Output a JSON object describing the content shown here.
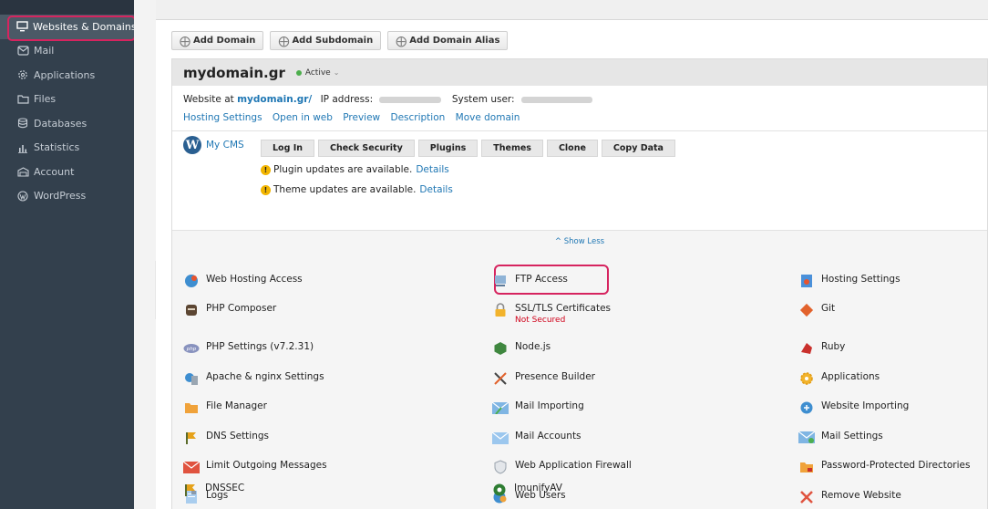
{
  "sidebar": {
    "items": [
      {
        "label": "Websites & Domains",
        "icon": "monitor-icon",
        "active": true
      },
      {
        "label": "Mail",
        "icon": "envelope-icon"
      },
      {
        "label": "Applications",
        "icon": "gear-icon"
      },
      {
        "label": "Files",
        "icon": "folder-icon"
      },
      {
        "label": "Databases",
        "icon": "database-icon"
      },
      {
        "label": "Statistics",
        "icon": "bar-chart-icon"
      },
      {
        "label": "Account",
        "icon": "account-icon"
      },
      {
        "label": "WordPress",
        "icon": "wordpress-icon"
      }
    ]
  },
  "toolbar": {
    "add_domain": "Add Domain",
    "add_subdomain": "Add Subdomain",
    "add_domain_alias": "Add Domain Alias"
  },
  "domain": {
    "name": "mydomain.gr",
    "status": "Active",
    "website_at_label": "Website at",
    "website_link": "mydomain.gr/",
    "ip_label": "IP address:",
    "system_user_label": "System user:",
    "links": [
      "Hosting Settings",
      "Open in web",
      "Preview",
      "Description",
      "Move domain"
    ]
  },
  "cms": {
    "name": "My CMS",
    "buttons": [
      "Log In",
      "Check Security",
      "Plugins",
      "Themes",
      "Clone",
      "Copy Data"
    ],
    "plugin_notice": "Plugin updates are available.",
    "theme_notice": "Theme updates are available.",
    "details": "Details"
  },
  "show_less": "^ Show Less",
  "tools": {
    "col1": [
      "Web Hosting Access",
      "PHP Composer",
      "PHP Settings (v7.2.31)",
      "Apache & nginx Settings",
      "File Manager",
      "DNS Settings",
      "Limit Outgoing Messages",
      "Logs",
      "DNSSEC"
    ],
    "col2": [
      "FTP Access",
      "SSL/TLS Certificates",
      "Node.js",
      "Presence Builder",
      "Mail Importing",
      "Mail Accounts",
      "Web Application Firewall",
      "Web Users",
      "ImunifyAV"
    ],
    "col3": [
      "Hosting Settings",
      "Git",
      "Ruby",
      "Applications",
      "Website Importing",
      "Mail Settings",
      "Password-Protected Directories",
      "Remove Website"
    ],
    "ssl_status": "Not Secured"
  },
  "colors": {
    "sidebar_bg": "#33404d",
    "highlight": "#d6245f",
    "link": "#1f77b4",
    "active_dot": "#4cae4c"
  }
}
